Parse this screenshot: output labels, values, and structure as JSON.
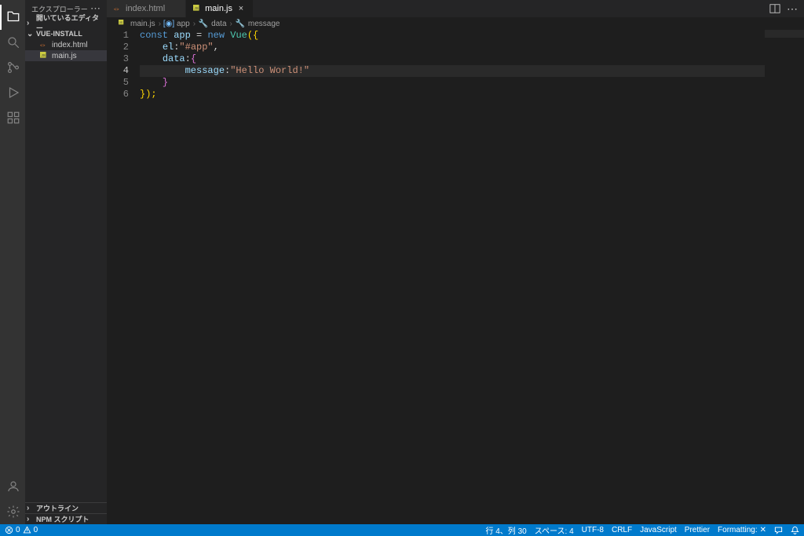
{
  "sidebar": {
    "title": "エクスプローラー",
    "sections": {
      "open_editors": "開いているエディター",
      "folder": "VUE-INSTALL",
      "outline": "アウトライン",
      "npm": "NPM スクリプト"
    },
    "files": [
      {
        "name": "index.html",
        "icon": "html"
      },
      {
        "name": "main.js",
        "icon": "js"
      }
    ]
  },
  "tabs": [
    {
      "name": "index.html",
      "icon": "html",
      "active": false
    },
    {
      "name": "main.js",
      "icon": "js",
      "active": true
    }
  ],
  "breadcrumb": [
    {
      "label": "main.js",
      "icon": "js"
    },
    {
      "label": "app",
      "icon": "var"
    },
    {
      "label": "data",
      "icon": "prop"
    },
    {
      "label": "message",
      "icon": "prop"
    }
  ],
  "code": {
    "lines": [
      "1",
      "2",
      "3",
      "4",
      "5",
      "6"
    ],
    "l1": {
      "const": "const",
      "app": "app",
      "eq": " = ",
      "new": "new",
      "Vue": "Vue",
      "open": "({"
    },
    "l2": {
      "pad": "    ",
      "el": "el",
      "col": ":",
      "str": "\"#app\"",
      "com": ","
    },
    "l3": {
      "pad": "    ",
      "data": "data",
      "col": ":",
      "br": "{"
    },
    "l4": {
      "pad": "        ",
      "msg": "message",
      "col": ":",
      "str": "\"Hello World!\""
    },
    "l5": {
      "pad": "    ",
      "br": "}"
    },
    "l6": {
      "close": "});"
    }
  },
  "status": {
    "errors": "0",
    "warnings": "0",
    "position": "行 4、列 30",
    "spaces": "スペース: 4",
    "encoding": "UTF-8",
    "eol": "CRLF",
    "language": "JavaScript",
    "prettier": "Prettier",
    "formatting": "Formatting:"
  }
}
